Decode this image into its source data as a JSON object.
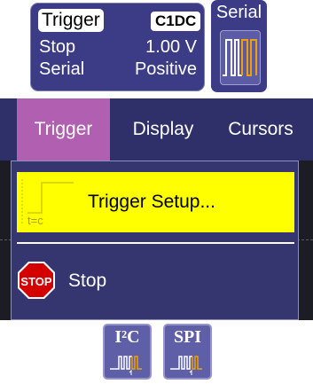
{
  "trigger_status": {
    "title": "Trigger",
    "channel": "C1DC",
    "mode_label": "Stop",
    "level": "1.00 V",
    "type_label": "Serial",
    "slope": "Positive"
  },
  "serial_icon": {
    "label": "Serial"
  },
  "menubar": {
    "tabs": [
      {
        "label": "Trigger",
        "active": true
      },
      {
        "label": "Display",
        "active": false
      },
      {
        "label": "Cursors",
        "active": false
      }
    ]
  },
  "dropdown": {
    "items": [
      {
        "label": "Trigger Setup...",
        "icon": "trigger-setup-icon",
        "highlighted": true,
        "icon_text": "t=c"
      },
      {
        "label": "Stop",
        "icon": "stop-sign-icon",
        "icon_text": "STOP"
      }
    ]
  },
  "bottom_icons": [
    {
      "label": "I²C",
      "icon": "i2c-trigger-icon"
    },
    {
      "label": "SPI",
      "icon": "spi-trigger-icon"
    }
  ],
  "colors": {
    "panel_bg": "#3c3c86",
    "tab_active": "#b15fb0",
    "highlight": "#ffff00",
    "stop_red": "#d40000",
    "wave_orange": "#f0a000"
  }
}
